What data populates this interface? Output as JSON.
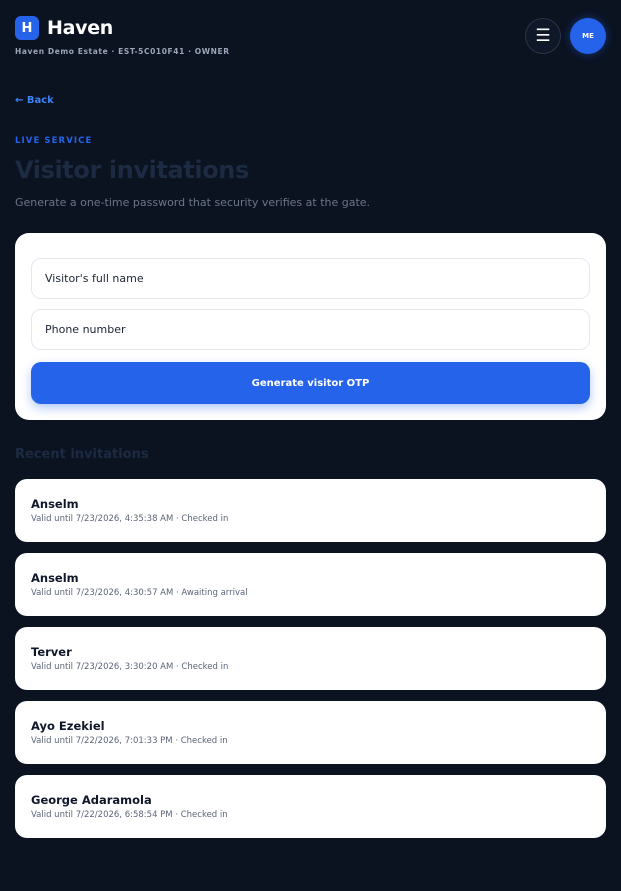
{
  "brand": {
    "logo_letter": "H",
    "name": "Haven",
    "estate_line": "Haven Demo Estate · EST-5C010F41 · OWNER"
  },
  "header": {
    "menu_icon": "☰",
    "avatar_initials": "ME"
  },
  "nav": {
    "back_label": "← Back"
  },
  "hero": {
    "eyebrow": "LIVE SERVICE",
    "title": "Visitor invitations",
    "subtitle": "Generate a one-time password that security verifies at the gate."
  },
  "form": {
    "name_placeholder": "Visitor's full name",
    "phone_placeholder": "Phone number",
    "submit_label": "Generate visitor OTP"
  },
  "recent": {
    "title": "Recent invitations",
    "items": [
      {
        "name": "Anselm",
        "meta": "Valid until 7/23/2026, 4:35:38 AM · Checked in"
      },
      {
        "name": "Anselm",
        "meta": "Valid until 7/23/2026, 4:30:57 AM · Awaiting arrival"
      },
      {
        "name": "Terver",
        "meta": "Valid until 7/23/2026, 3:30:20 AM · Checked in"
      },
      {
        "name": "Ayo Ezekiel",
        "meta": "Valid until 7/22/2026, 7:01:33 PM · Checked in"
      },
      {
        "name": "George Adaramola",
        "meta": "Valid until 7/22/2026, 6:58:54 PM · Checked in"
      }
    ]
  },
  "colors": {
    "background": "#0b1220",
    "accent": "#2563eb",
    "card": "#ffffff"
  }
}
